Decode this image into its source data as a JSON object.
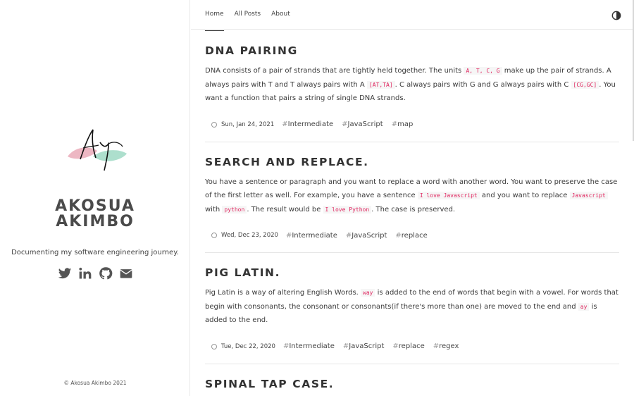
{
  "sidebar": {
    "title_line1": "AKOSUA",
    "title_line2": "AKIMBO",
    "tagline": "Documenting my software engineering journey.",
    "social_icons": [
      "twitter-icon",
      "linkedin-icon",
      "github-icon",
      "envelope-icon"
    ],
    "copyright": "© Akosua Akimbo 2021"
  },
  "nav": {
    "links": [
      "Home",
      "All Posts",
      "About"
    ],
    "active": "Home",
    "theme_icon": "contrast-icon"
  },
  "colors": {
    "code_text": "#e0245e",
    "accent_pink": "#e8a5b4",
    "accent_green": "#9fd9c4"
  },
  "posts": [
    {
      "title": "DNA PAIRING",
      "desc": [
        {
          "t": "DNA consists of a pair of strands that are tightly held together. The units "
        },
        {
          "c": "A, T, C, G"
        },
        {
          "t": " make up the pair of strands. A always pairs with T and T always pairs with A "
        },
        {
          "c": "[AT,TA]"
        },
        {
          "t": ". C always pairs with G and G always pairs with C "
        },
        {
          "c": "[CG,GC]"
        },
        {
          "t": ". You want a function that pairs a string of single DNA strands."
        }
      ],
      "date": "Sun, Jan 24, 2021",
      "tags": [
        "Intermediate",
        "JavaScript",
        "map"
      ]
    },
    {
      "title": "SEARCH AND REPLACE.",
      "desc": [
        {
          "t": "You have a sentence or paragraph and you want to replace a word with another word. You want to preserve the case of the first letter as well. For example, you have a sentence "
        },
        {
          "c": "I love Javascript"
        },
        {
          "t": " and you want to replace "
        },
        {
          "c": "Javascript"
        },
        {
          "t": " with "
        },
        {
          "c": "python"
        },
        {
          "t": ". The result would be "
        },
        {
          "c": "I love Python"
        },
        {
          "t": ". The case is preserved."
        }
      ],
      "date": "Wed, Dec 23, 2020",
      "tags": [
        "Intermediate",
        "JavaScript",
        "replace"
      ]
    },
    {
      "title": "PIG LATIN.",
      "desc": [
        {
          "t": "Pig Latin is a way of altering English Words. "
        },
        {
          "c": "way"
        },
        {
          "t": " is added to the end of words that begin with a vowel. For words that begin with consonants, the consonant or consonants(if there's more than one) are moved to the end and "
        },
        {
          "c": "ay"
        },
        {
          "t": " is added to the end."
        }
      ],
      "date": "Tue, Dec 22, 2020",
      "tags": [
        "Intermediate",
        "JavaScript",
        "replace",
        "regex"
      ]
    },
    {
      "title": "SPINAL TAP CASE.",
      "desc": [],
      "date": "",
      "tags": []
    }
  ]
}
